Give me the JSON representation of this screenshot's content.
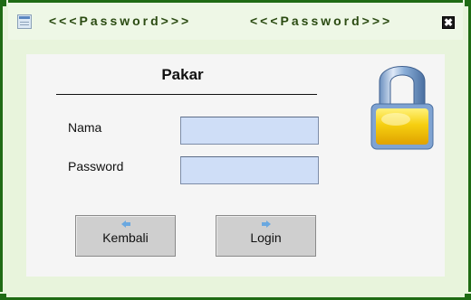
{
  "window": {
    "title_left": "<<<Password>>>",
    "title_right": "<<<Password>>>",
    "close_glyph": "✖"
  },
  "form": {
    "heading": "Pakar",
    "nama_label": "Nama",
    "nama_value": "",
    "password_label": "Password",
    "password_value": ""
  },
  "buttons": {
    "back_label": "Kembali",
    "back_icon": "arrow-left-icon",
    "login_label": "Login",
    "login_icon": "arrow-right-icon"
  },
  "colors": {
    "frame": "#1f6b14",
    "field_bg": "#cfdef7",
    "button_bg": "#cfcfcf",
    "lock_body": "#f2c200"
  }
}
